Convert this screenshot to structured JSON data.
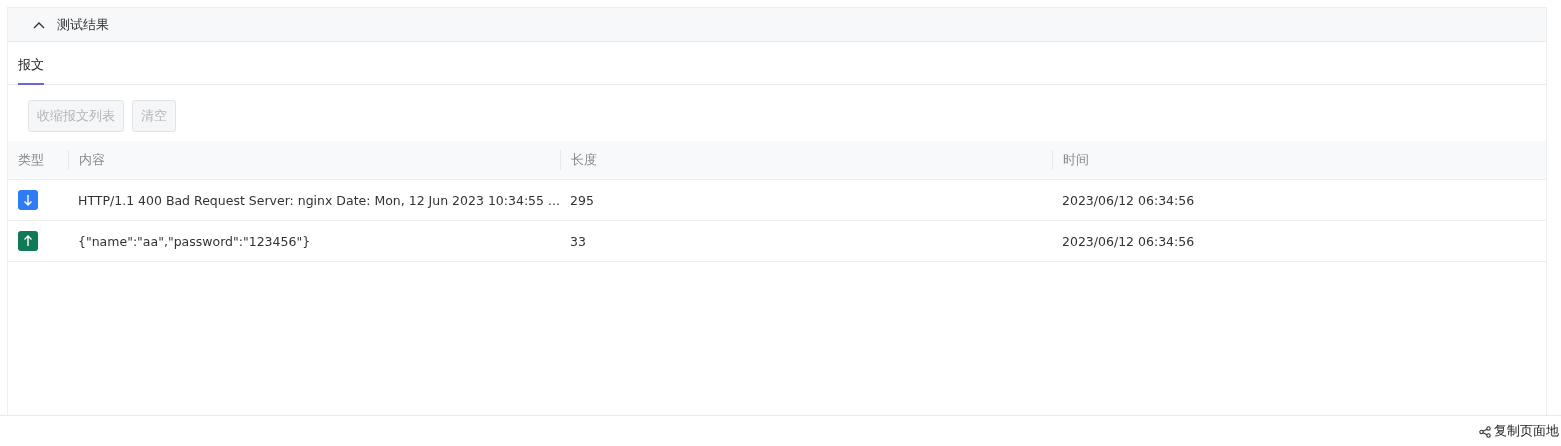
{
  "section": {
    "title": "测试结果",
    "expanded": true
  },
  "tabs": [
    {
      "label": "报文",
      "selected": true
    }
  ],
  "toolbar": [
    {
      "label": "收缩报文列表",
      "disabled": true
    },
    {
      "label": "清空",
      "disabled": true
    }
  ],
  "table": {
    "columns": [
      "类型",
      "内容",
      "长度",
      "时间"
    ],
    "rows": [
      {
        "kind": "received",
        "content": "HTTP/1.1 400 Bad Request Server: nginx Date: Mon, 12 Jun 2023 10:34:55 ...",
        "length": "295",
        "time": "2023/06/12 06:34:56"
      },
      {
        "kind": "sent",
        "content": "{\"name\":\"aa\",\"password\":\"123456\"}",
        "length": "33",
        "time": "2023/06/12 06:34:56"
      }
    ]
  },
  "footer": {
    "link": "复制页面地"
  }
}
